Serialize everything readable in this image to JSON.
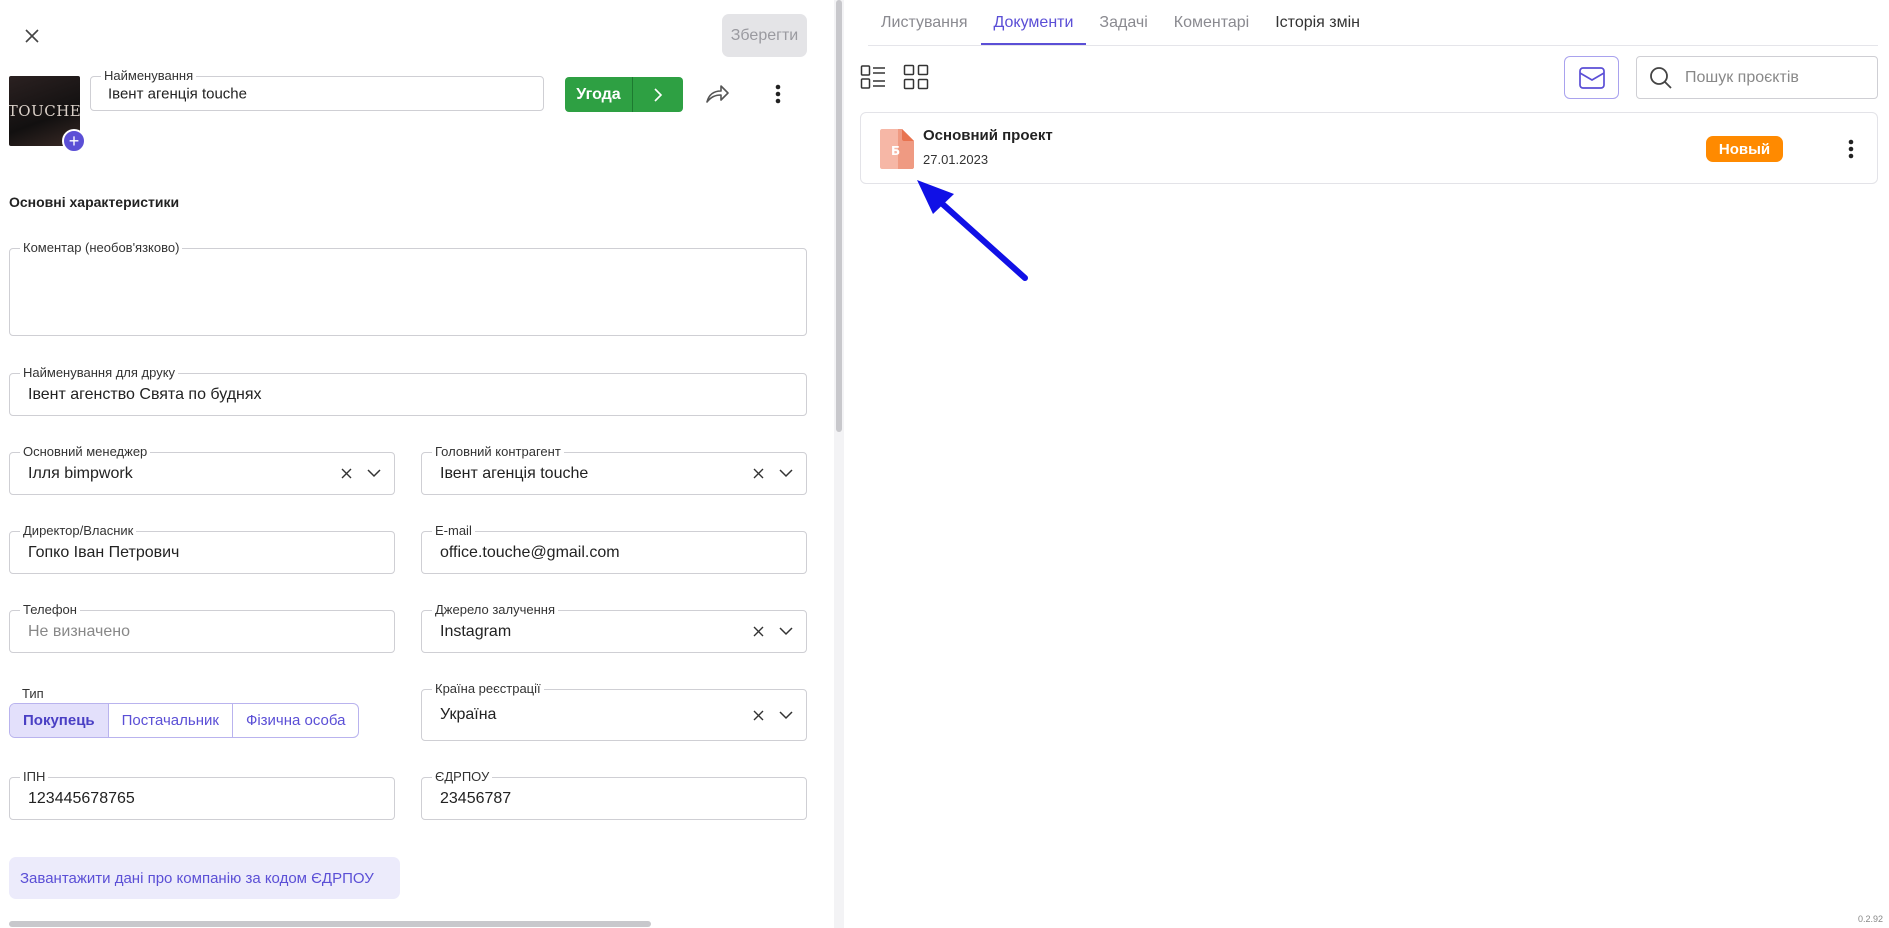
{
  "header": {
    "save_label": "Зберегти",
    "deal_label": "Угода"
  },
  "avatar": {
    "logo_text": "TOUCHE"
  },
  "fields": {
    "name": {
      "label": "Найменування",
      "value": "Івент агенція touche"
    },
    "comment": {
      "label": "Коментар (необов'язково)",
      "value": ""
    },
    "print_name": {
      "label": "Найменування для друку",
      "value": "Івент агенство Свята по буднях"
    },
    "manager": {
      "label": "Основний менеджер",
      "value": "Ілля bimpwork"
    },
    "counterparty": {
      "label": "Головний контрагент",
      "value": "Івент агенція touche"
    },
    "director": {
      "label": "Директор/Власник",
      "value": "Гопко Іван Петрович"
    },
    "email": {
      "label": "E-mail",
      "value": "office.touche@gmail.com"
    },
    "phone": {
      "label": "Телефон",
      "placeholder": "Не визначено"
    },
    "source": {
      "label": "Джерело залучення",
      "value": "Instagram"
    },
    "country": {
      "label": "Країна реєстрації",
      "value": "Україна"
    },
    "ipn": {
      "label": "ІПН",
      "value": "123445678765"
    },
    "edrpou": {
      "label": "ЄДРПОУ",
      "value": "23456787"
    }
  },
  "section_title": "Основні характеристики",
  "type": {
    "label": "Тип",
    "options": [
      "Покупець",
      "Постачальник",
      "Фізична особа"
    ],
    "selected": "Покупець"
  },
  "load_button": "Завантажити дані про компанію за кодом ЄДРПОУ",
  "tabs": [
    "Листування",
    "Документи",
    "Задачі",
    "Коментарі",
    "Історія змін"
  ],
  "active_tab": "Документи",
  "search": {
    "placeholder": "Пошук проєктів"
  },
  "documents": [
    {
      "icon_letter": "Б",
      "title": "Основний проект",
      "date": "27.01.2023",
      "status": "Новый"
    }
  ],
  "colors": {
    "accent": "#5b4fd6",
    "deal_green": "#2ea043",
    "status_orange": "#ff8a00",
    "doc_icon": "#f2a48f",
    "annotation_arrow": "#1010e6"
  },
  "icons": [
    "close-icon",
    "plus-icon",
    "chevron-right-icon",
    "share-icon",
    "more-vertical-icon",
    "clear-x-icon",
    "chevron-down-icon",
    "list-view-icon",
    "grid-view-icon",
    "archive-icon",
    "search-icon",
    "document-icon"
  ],
  "version": "0.2.92"
}
